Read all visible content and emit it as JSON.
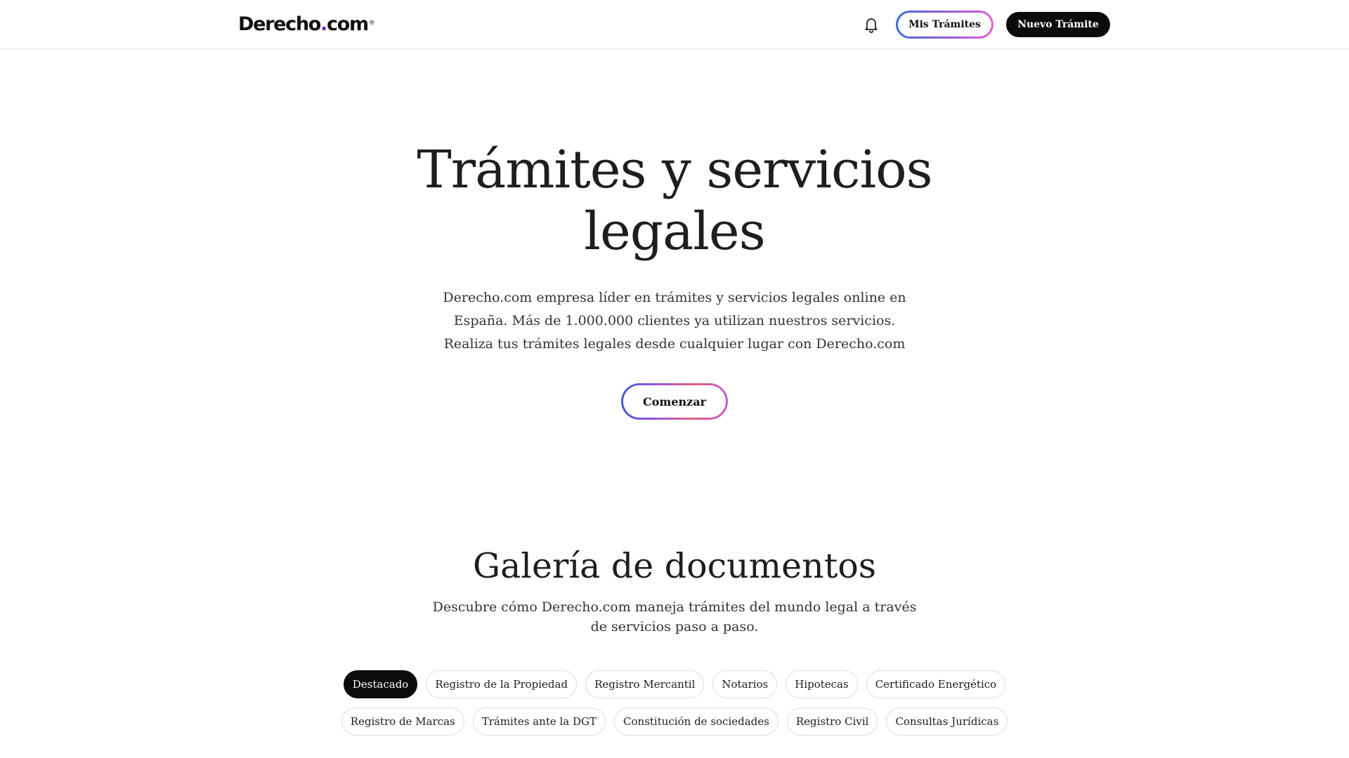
{
  "header": {
    "logo_text": "Derecho",
    "logo_dot": ".",
    "logo_suffix": "com",
    "logo_reg": "®",
    "notifications_icon": "bell-icon",
    "mis_tramites_label": "Mis Trámites",
    "nuevo_tramite_label": "Nuevo Trámite"
  },
  "hero": {
    "title": "Trámites y servicios legales",
    "description": "Derecho.com empresa líder en trámites y servicios legales online en España. Más de 1.000.000 clientes ya utilizan nuestros servicios. Realiza tus trámites legales desde cualquier lugar con Derecho.com",
    "cta_label": "Comenzar"
  },
  "gallery": {
    "title": "Galería de documentos",
    "description": "Descubre cómo Derecho.com maneja trámites del mundo legal a través de servicios paso a paso.",
    "chips": [
      "Destacado",
      "Registro de la Propiedad",
      "Registro Mercantil",
      "Notarios",
      "Hipotecas",
      "Certificado Energético",
      "Registro de Marcas",
      "Trámites ante la DGT",
      "Constitución de sociedades",
      "Registro Civil",
      "Consultas Jurídicas"
    ],
    "active_chip": "Destacado"
  },
  "colors": {
    "brand_purple": "#6d28d9",
    "dark_button": "#0b0b0b",
    "gradient_start": "#3b6fd8",
    "gradient_end": "#e25fd2"
  }
}
